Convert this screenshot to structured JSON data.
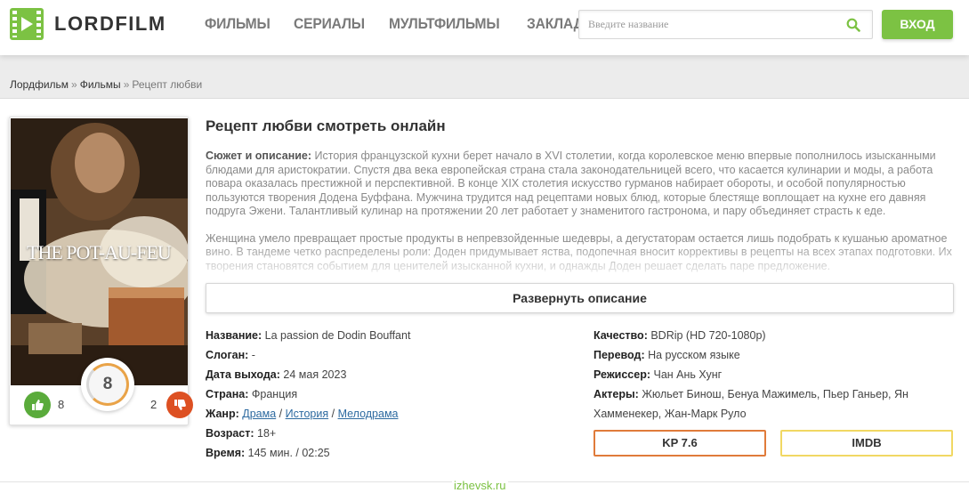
{
  "header": {
    "logo_text": "LORDFILM",
    "nav": [
      "ФИЛЬМЫ",
      "СЕРИАЛЫ",
      "МУЛЬТФИЛЬМЫ",
      "ЗАКЛАДКИ"
    ],
    "search_placeholder": "Введите название",
    "login_label": "ВХОД"
  },
  "breadcrumb": {
    "home": "Лордфильм",
    "sep1": "»",
    "section": "Фильмы",
    "sep2": "»",
    "current": "Рецепт любви"
  },
  "poster": {
    "title_art": "THE POT-AU-FEU"
  },
  "rating": {
    "likes": "8",
    "dislikes": "2",
    "score": "8"
  },
  "title": "Рецепт любви смотреть онлайн",
  "description": {
    "label": "Сюжет и описание:",
    "p1": " История французской кухни берет начало в XVI столетии, когда королевское меню впервые пополнилось изысканными блюдами для аристократии. Спустя два века европейская страна стала законодательницей всего, что касается кулинарии и моды, а работа повара оказалась престижной и перспективной. В конце XIX столетия искусство гурманов набирает обороты, и особой популярностью пользуются творения Додена Буффана. Мужчина трудится над рецептами новых блюд, которые блестяще воплощает на кухне его давняя подруга Эжени. Талантливый кулинар на протяжении 20 лет работает у знаменитого гастронома, и пару объединяет страсть к еде.",
    "p2": "Женщина умело превращает простые продукты в непревзойденные шедевры, а дегустаторам остается лишь подобрать к кушанью ароматное вино. В тандеме четко распределены роли: Доден придумывает яства, подопечная вносит коррективы в рецепты на всех этапах подготовки. Их творения становятся событием для ценителей изысканной кухни, и однажды Доден решает сделать паре предложение.",
    "expand_label": "Развернуть описание"
  },
  "info_left": {
    "name_label": "Название:",
    "name_value": "La passion de Dodin Bouffant",
    "slogan_label": "Слоган:",
    "slogan_value": "-",
    "release_label": "Дата выхода:",
    "release_value": "24 мая 2023",
    "country_label": "Страна:",
    "country_value": "Франция",
    "genre_label": "Жанр:",
    "genres": [
      "Драма",
      "История",
      "Мелодрама"
    ],
    "genre_sep": "/",
    "age_label": "Возраст:",
    "age_value": "18+",
    "time_label": "Время:",
    "time_value": "145 мин. / 02:25"
  },
  "info_right": {
    "quality_label": "Качество:",
    "quality_value": "BDRip (HD 720-1080p)",
    "translation_label": "Перевод:",
    "translation_value": "На русском языке",
    "director_label": "Режиссер:",
    "director_value": "Чан Ань Хунг",
    "actors_label": "Актеры:",
    "actors_value": "Жюльет Бинош, Бенуа Мажимель, Пьер Ганьер, Ян Хамменекер, Жан-Марк Руло"
  },
  "scores": {
    "kp": "KP  7.6",
    "imdb": "IMDB"
  },
  "watermark": "izhevsk.ru",
  "colors": {
    "accent": "#7cc243",
    "like": "#5aab3b",
    "dislike": "#dd5022",
    "kp_border": "#e07b3a",
    "imdb_border": "#f1d863",
    "link": "#2d6aa0"
  }
}
